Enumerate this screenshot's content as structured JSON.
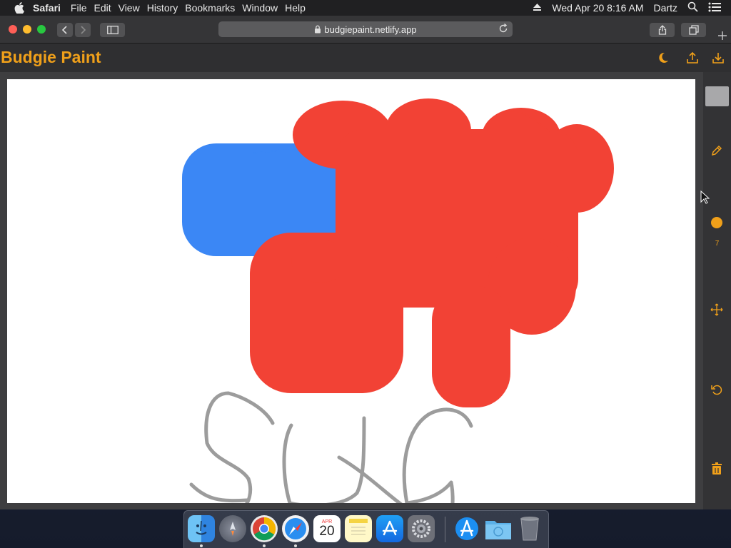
{
  "menubar": {
    "app_name": "Safari",
    "items": [
      "File",
      "Edit",
      "View",
      "History",
      "Bookmarks",
      "Window",
      "Help"
    ],
    "datetime": "Wed Apr 20  8:16 AM",
    "user": "Dartz"
  },
  "browser": {
    "url": "budgiepaint.netlify.app"
  },
  "app": {
    "title": "Budgie Paint",
    "accent_color": "#f0a01a",
    "brush_size": "7",
    "selected_color": "#a8a8aa",
    "header_icons": [
      "moon-icon",
      "upload-icon",
      "download-icon"
    ],
    "side_tools": [
      "color-swatch",
      "pencil-icon",
      "brush-size-icon",
      "move-icon",
      "undo-icon",
      "trash-icon"
    ]
  },
  "canvas": {
    "stroke_colors": {
      "red": "#f24235",
      "blue": "#3b87f5",
      "gray": "#9c9c9c"
    }
  },
  "dock": {
    "apps": [
      "Finder",
      "Launchpad",
      "Google Chrome",
      "Safari",
      "Calendar",
      "Notes",
      "App Store",
      "System Preferences",
      "App Store Folder",
      "Downloads",
      "Trash"
    ],
    "calendar_day": "20",
    "calendar_month": "APR"
  }
}
